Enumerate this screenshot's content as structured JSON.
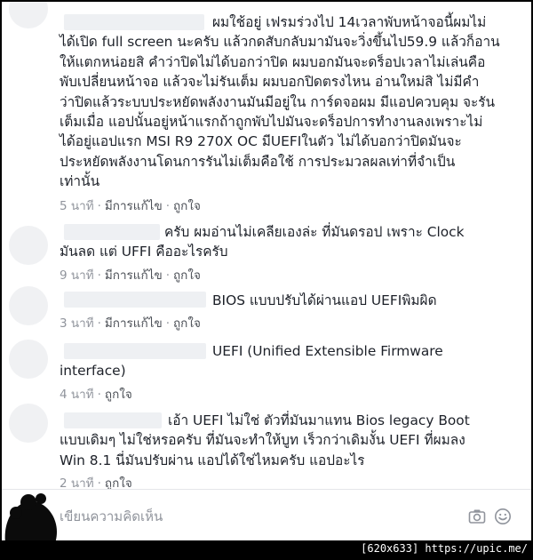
{
  "comments": [
    {
      "text": "ผมใช้อยู่ เฟรมร่วงไป 14เวลาพับหน้าจอนี้ผมไม่\nได้เปิด full screen นะครับ แล้วกดสับกลับมามันจะวิ่งขึ้นไป59.9 แล้วก็อาน\nให้แตกหน่อยสิ คำว่าปิดไม่ได้บอกว่าปิด ผมบอกมันจะดร็อปเวลาไม่เล่นคือ\nพับเปลี่ยนหน้าจอ แล้วจะไม่รันเต็ม ผมบอกปิดตรงไหน อ่านใหม่สิ ไม่มีคำ\nว่าปิดแล้วระบบประหยัดพลังงานมันมีอยู่ใน การ์ดจอผม มีแอปควบคุม จะรัน\nเต็มเมื่อ แอปนั้นอยู่หน้าแรกถ้าถูกพับไปมันจะดร็อปการทำงานลงเพราะไม่\nได้อยู่แอปแรก MSI R9 270X OC มีUEFIในตัว ไม่ได้บอกว่าปิดมันจะ\nประหยัดพลังงานโดนการรันไม่เต็มคือใช้ การประมวลผลเท่าที่จำเป็น\nเท่านั้น",
      "time": "5 นาที",
      "edited": "มีการแก้ไข",
      "like": "ถูกใจ"
    },
    {
      "text": "ครับ ผมอ่านไม่เคลียเองล่ะ ที่มันดรอป เพราะ Clock\nมันลด แต่ UFFI คืออะไรครับ",
      "time": "9 นาที",
      "edited": "มีการแก้ไข",
      "like": "ถูกใจ"
    },
    {
      "text": "BIOS แบบปรับได้ผ่านแอป UEFIพิมผิด",
      "time": "3 นาที",
      "edited": "มีการแก้ไข",
      "like": "ถูกใจ"
    },
    {
      "text": "UEFI (Unified Extensible Firmware\ninterface)",
      "time": "4 นาที",
      "like": "ถูกใจ"
    },
    {
      "text": "เอ้า UEFI ไม่ใช่ ตัวที่มันมาแทน Bios legacy Boot\nแบบเดิมๆ ไม่ใช่หรอครับ ที่มันจะทำให้บูท เร็วกว่าเดิมงั้น UEFI ที่ผมลง\nWin 8.1 นี่มันปรับผ่าน แอปได้ใช่ไหมครับ แอปอะไร",
      "time": "2 นาที",
      "like": "ถูกใจ"
    }
  ],
  "separator": "·",
  "composer": {
    "placeholder": "เขียนความคิดเห็น"
  },
  "icons": {
    "camera": "camera-icon",
    "emoji": "emoji-icon"
  },
  "watermark": "[620x633] https://upic.me/",
  "colors": {
    "text": "#1d2129",
    "meta": "#90949c",
    "background": "#ffffff",
    "frame": "#000000"
  }
}
